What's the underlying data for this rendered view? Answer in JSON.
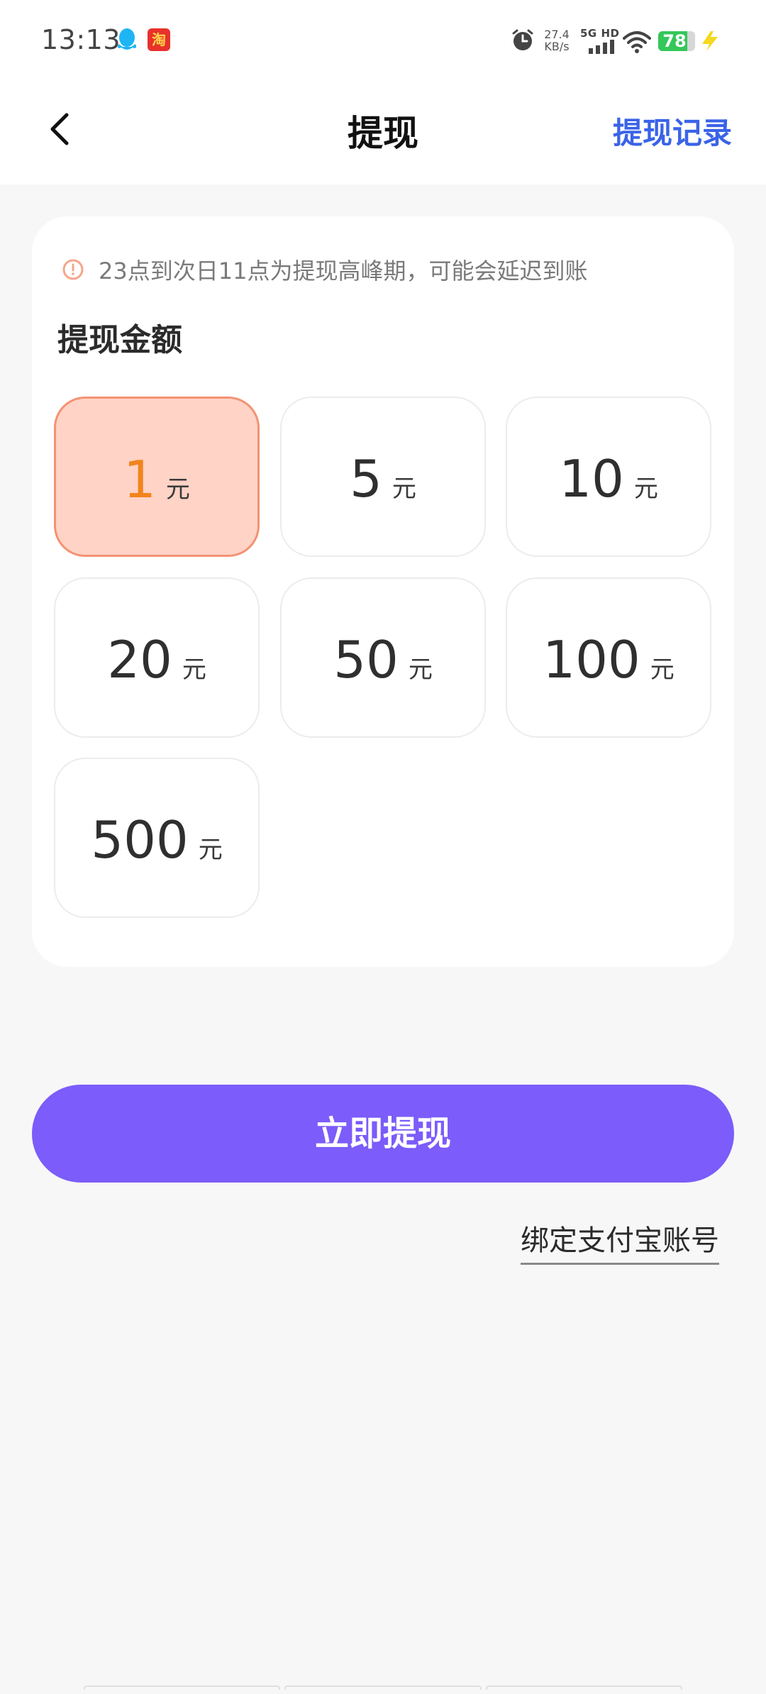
{
  "status_bar": {
    "time": "13:13",
    "net_speed_value": "27.4",
    "net_speed_unit": "KB/s",
    "network_label": "5G HD",
    "battery_level": "78",
    "battery_fraction": 0.78,
    "icons": [
      "qq-icon",
      "taobao-icon",
      "alarm-icon",
      "signal-icon",
      "wifi-icon",
      "battery-icon",
      "charge-icon"
    ],
    "taobao_glyph": "淘"
  },
  "header": {
    "title": "提现",
    "records_label": "提现记录"
  },
  "card": {
    "notice": "23点到次日11点为提现高峰期，可能会延迟到账",
    "amount_label": "提现金额",
    "unit": "元",
    "options": [
      {
        "value": "1",
        "selected": true
      },
      {
        "value": "5",
        "selected": false
      },
      {
        "value": "10",
        "selected": false
      },
      {
        "value": "20",
        "selected": false
      },
      {
        "value": "50",
        "selected": false
      },
      {
        "value": "100",
        "selected": false
      },
      {
        "value": "500",
        "selected": false
      }
    ]
  },
  "actions": {
    "withdraw_label": "立即提现",
    "bind_alipay_label": "绑定支付宝账号"
  },
  "colors": {
    "accent_button": "#7c5cfa",
    "link_blue": "#3a63e8",
    "selected_bg": "#ffd3c6",
    "selected_border": "#f49273",
    "selected_text": "#f2841c"
  }
}
